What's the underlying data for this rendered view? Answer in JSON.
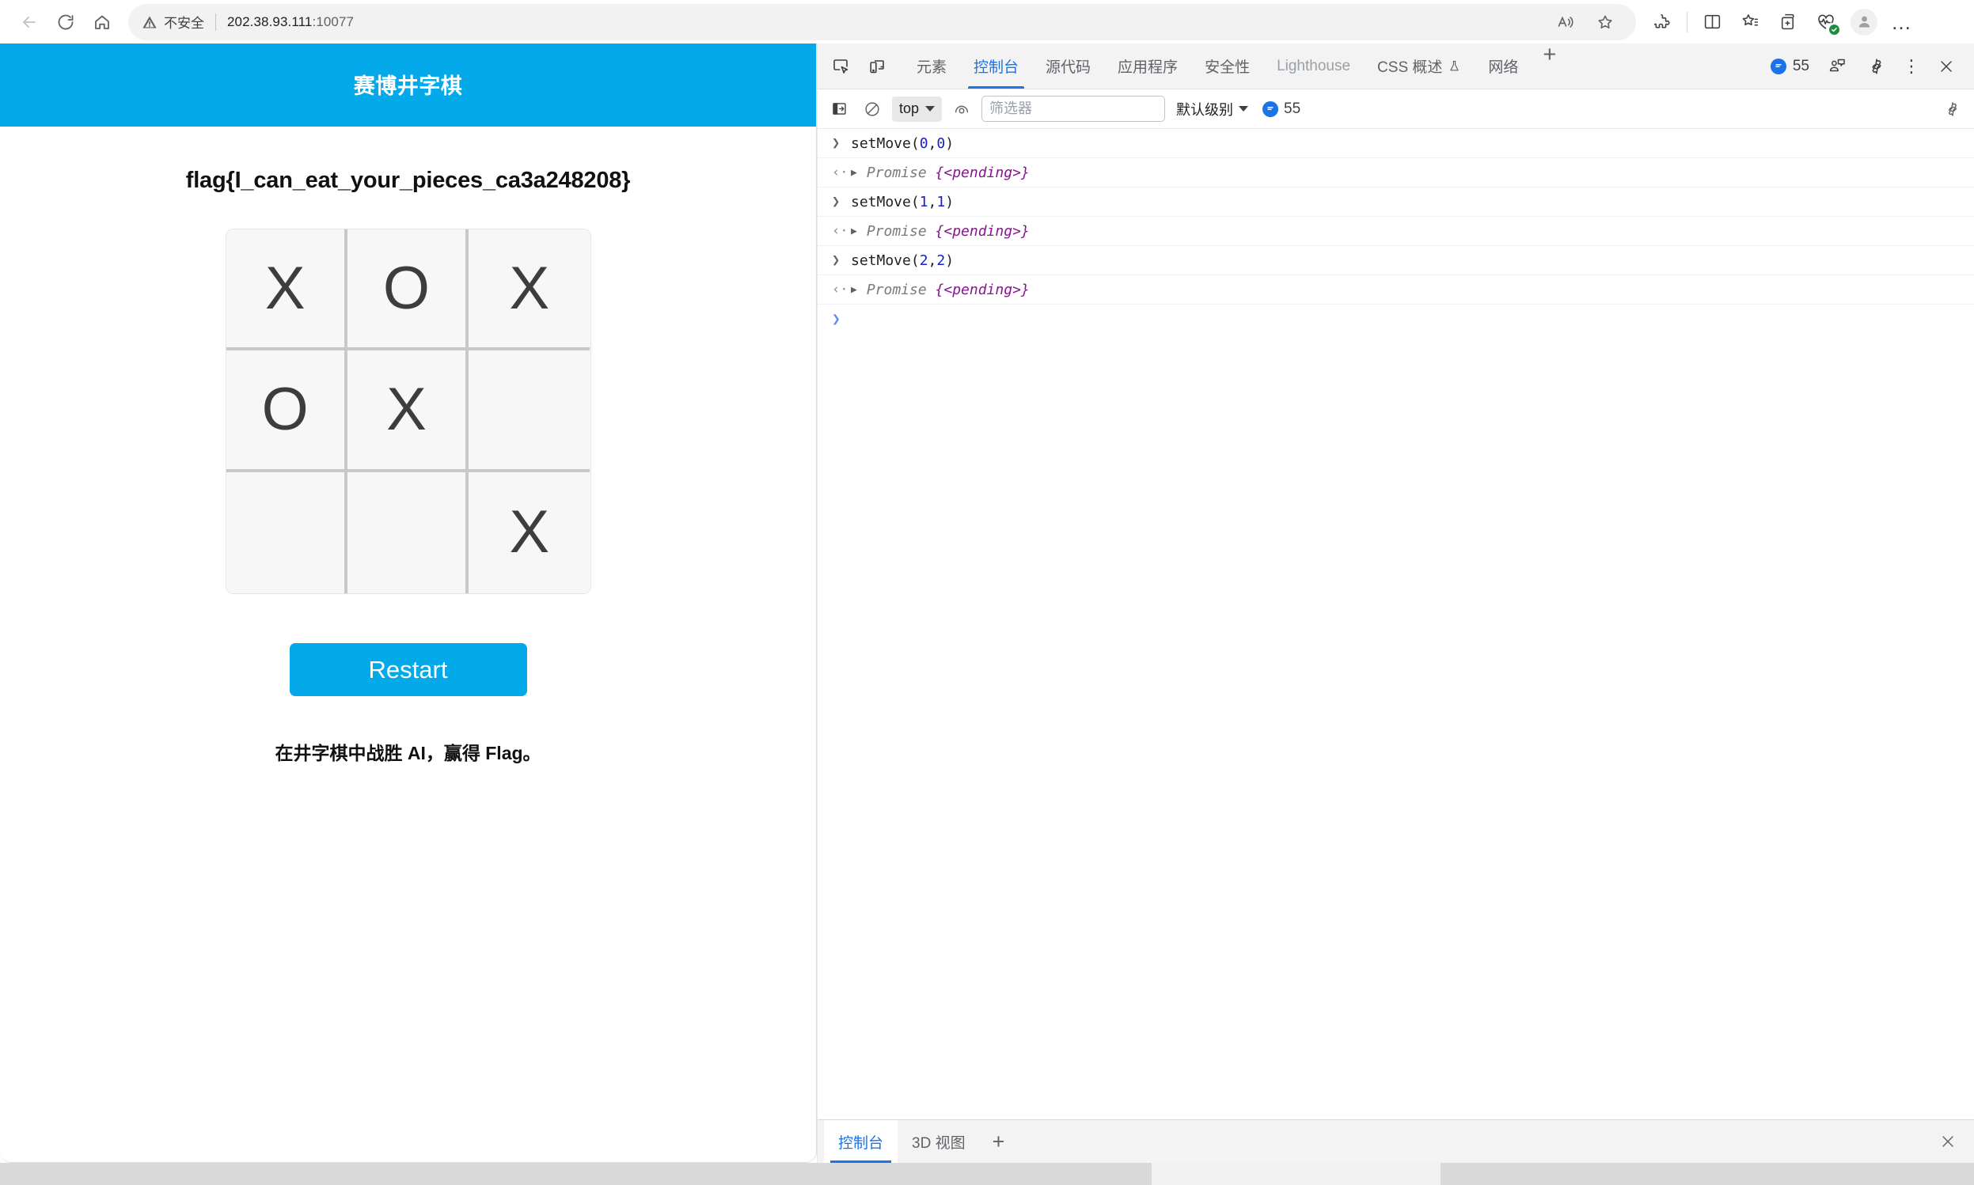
{
  "browser": {
    "nav": {
      "back_title": "后退",
      "refresh_title": "刷新",
      "home_title": "主页"
    },
    "address": {
      "security_label": "不安全",
      "url_host": "202.38.93.111",
      "url_port": ":10077",
      "read_aloud_title": "朗读此页面",
      "favorite_title": "添加到收藏夹"
    },
    "toolbar_icons": [
      "extensions-icon",
      "split-screen-icon",
      "collections-icon",
      "add-tab-to-collection-icon",
      "browser-essentials-icon",
      "profile-avatar-icon",
      "settings-and-more-icon"
    ]
  },
  "page": {
    "header_title": "赛博井字棋",
    "flag": "flag{I_can_eat_your_pieces_ca3a248208}",
    "board": {
      "cells": [
        "X",
        "O",
        "X",
        "O",
        "X",
        "",
        "",
        "",
        "X"
      ]
    },
    "restart_label": "Restart",
    "hint": "在井字棋中战胜 AI，赢得 Flag。",
    "brand_color": "#03a9e9"
  },
  "devtools": {
    "tabs": [
      {
        "label": "元素",
        "active": false,
        "muted": false,
        "flask": false
      },
      {
        "label": "控制台",
        "active": true,
        "muted": false,
        "flask": false
      },
      {
        "label": "源代码",
        "active": false,
        "muted": false,
        "flask": false
      },
      {
        "label": "应用程序",
        "active": false,
        "muted": false,
        "flask": false
      },
      {
        "label": "安全性",
        "active": false,
        "muted": false,
        "flask": false
      },
      {
        "label": "Lighthouse",
        "active": false,
        "muted": true,
        "flask": false
      },
      {
        "label": "CSS 概述",
        "active": false,
        "muted": false,
        "flask": true
      },
      {
        "label": "网络",
        "active": false,
        "muted": false,
        "flask": false
      }
    ],
    "add_tab_label": "+",
    "issues_count_tabbar": "55",
    "right_icons": [
      "issues-icon",
      "feedback-icon",
      "settings-gear-icon",
      "more-options-icon",
      "close-devtools-icon"
    ],
    "kebab": "⋮",
    "toolbar": {
      "sidebar_toggle_title": "控制台边栏",
      "clear_console_title": "清除控制台",
      "context": "top",
      "live_expression_title": "创建实时表达式",
      "filter_placeholder": "筛选器",
      "filter_value": "",
      "level": "默认级别",
      "issues_count": "55",
      "settings_title": "控制台设置"
    },
    "console_rows": [
      {
        "kind": "input",
        "arrow": "❯",
        "expr_name": "setMove(",
        "arg1": "0",
        "comma": ",",
        "arg2": "0",
        "close": ")"
      },
      {
        "kind": "output",
        "arrow": "‹·",
        "promise": "Promise ",
        "pending": "{<pending>}"
      },
      {
        "kind": "input",
        "arrow": "❯",
        "expr_name": "setMove(",
        "arg1": "1",
        "comma": ",",
        "arg2": "1",
        "close": ")"
      },
      {
        "kind": "output",
        "arrow": "‹·",
        "promise": "Promise ",
        "pending": "{<pending>}"
      },
      {
        "kind": "input",
        "arrow": "❯",
        "expr_name": "setMove(",
        "arg1": "2",
        "comma": ",",
        "arg2": "2",
        "close": ")"
      },
      {
        "kind": "output",
        "arrow": "‹·",
        "promise": "Promise ",
        "pending": "{<pending>}"
      }
    ],
    "prompt_chevron": "❯",
    "prompt_value": "",
    "drawer_tabs": [
      {
        "label": "控制台",
        "active": true
      },
      {
        "label": "3D 视图",
        "active": false
      }
    ],
    "drawer_add_label": "+",
    "drawer_close_title": "关闭抽屉",
    "accent_color": "#1a73e8"
  }
}
